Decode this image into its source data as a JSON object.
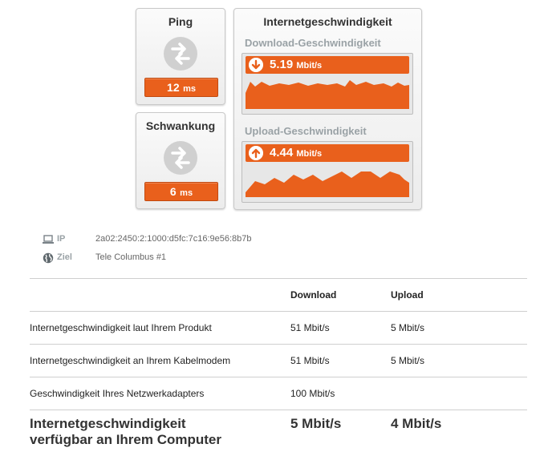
{
  "ping": {
    "title": "Ping",
    "value": "12",
    "unit": "ms"
  },
  "jitter": {
    "title": "Schwankung",
    "value": "6",
    "unit": "ms"
  },
  "speed": {
    "title": "Internetgeschwindigkeit",
    "download": {
      "title": "Download-Geschwindigkeit",
      "value": "5.19",
      "unit": "Mbit/s",
      "direction_icon": "arrow-down-icon"
    },
    "upload": {
      "title": "Upload-Geschwindigkeit",
      "value": "4.44",
      "unit": "Mbit/s",
      "direction_icon": "arrow-up-icon"
    }
  },
  "info": {
    "ip": {
      "label": "IP",
      "value": "2a02:2450:2:1000:d5fc:7c16:9e56:8b7b",
      "icon": "laptop-icon"
    },
    "target": {
      "label": "Ziel",
      "value": "Tele Columbus #1",
      "icon": "globe-icon"
    }
  },
  "table": {
    "headers": [
      "",
      "Download",
      "Upload"
    ],
    "rows": [
      [
        "Internetgeschwindigkeit laut Ihrem Produkt",
        "51 Mbit/s",
        "5 Mbit/s"
      ],
      [
        "Internetgeschwindigkeit an Ihrem Kabelmodem",
        "51 Mbit/s",
        "5 Mbit/s"
      ],
      [
        "Geschwindigkeit Ihres Netzwerkadapters",
        "100 Mbit/s",
        ""
      ]
    ],
    "final": {
      "label_line1": "Internetgeschwindigkeit",
      "label_line2": "verfügbar an Ihrem Computer",
      "download": "5 Mbit/s",
      "upload": "4 Mbit/s"
    }
  },
  "colors": {
    "accent": "#e9601c",
    "muted_label": "#9aa2a6"
  }
}
